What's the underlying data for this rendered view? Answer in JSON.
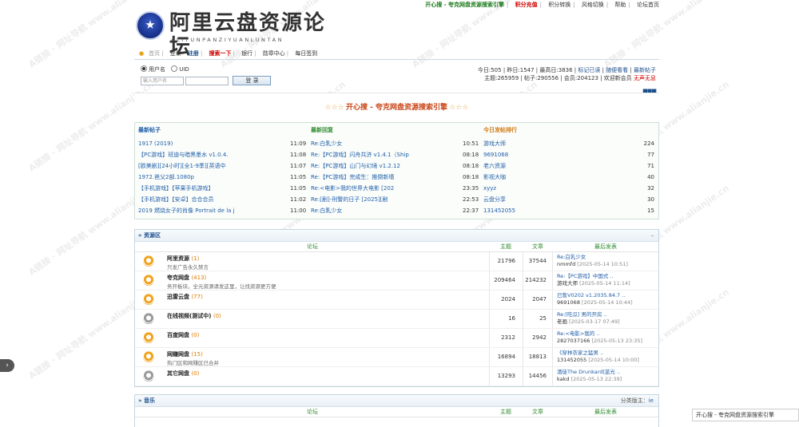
{
  "topbar": {
    "items": [
      "开心搜 - 夸克网盘资源搜索引擎",
      "积分充值",
      "积分转换",
      "风格切换",
      "帮助",
      "论坛首页"
    ],
    "separators": [
      "|",
      "|",
      "|",
      "|",
      "|"
    ]
  },
  "logo": {
    "title": "阿里云盘资源论坛",
    "subtitle": "ALIYUNPANZIYUANLUNTAN"
  },
  "nav": {
    "home": "首页",
    "items": [
      "登录",
      "注册",
      "搜索一下",
      "银行",
      "勋章中心",
      "每日签到"
    ],
    "separators": [
      "|",
      "|",
      "|",
      "|",
      "|"
    ]
  },
  "login": {
    "radio_username": "用户名",
    "radio_uid": "UID",
    "input_placeholder": "输入用户名",
    "submit": "登 录"
  },
  "stats": {
    "line1_prefix": "今日:505 | 昨日:1547 | 最高日:3836 | ",
    "line1_link1": "标记已读",
    "line1_mid": " | ",
    "line1_link2": "随便看看",
    "line1_sep2": " | ",
    "line1_link3": "最新帖子",
    "line2_prefix": "主题:265959 | 帖子:290556 | 会员:204123 | 欢迎新会员 ",
    "line2_user": "无声无息"
  },
  "dots": "■■■",
  "banner": {
    "stars_left": "☆☆☆",
    "text": "开心搜 - 夸克网盘资源搜索引擎",
    "stars_right": "☆☆☆"
  },
  "latest": {
    "new_posts_title": "最新帖子",
    "new_replies_title": "最新回复",
    "ranking_title": "今日发帖排行",
    "new_posts": [
      {
        "title": "1917 (2019)",
        "time": "11:09"
      },
      {
        "title": "【PC游戏】班迪与暗黑墨水 v1.0.4.",
        "time": "11:08"
      },
      {
        "title": "[欧美剧][24小时][全1-9季][英语中",
        "time": "11:07"
      },
      {
        "title": "1972.爸父2部.1080p",
        "time": "11:05"
      },
      {
        "title": "【手机游戏】【苹果手机游戏】",
        "time": "11:05"
      },
      {
        "title": "【手机游戏】【安卓】合合合员",
        "time": "11:02"
      },
      {
        "title": "2019 燃烧女子的肖像 Portrait de la j",
        "time": "11:00"
      }
    ],
    "new_replies": [
      {
        "title": "Re:白乳少女",
        "time": "10:51"
      },
      {
        "title": "Re:【PC游戏】闪舟共济 v1.4.1（Ship",
        "time": "08:18"
      },
      {
        "title": "Re:【PC游戏】山门与幻境 v1.2.12",
        "time": "08:18"
      },
      {
        "title": "Re:【PC游戏】完成生：推倒新墙",
        "time": "08:18"
      },
      {
        "title": "Re:<电影>我的世界大电影 [202",
        "time": "23:35"
      },
      {
        "title": "Re:[剧]-刑警的日子 [2025][剧",
        "time": "22:53"
      },
      {
        "title": "Re:白乳少女",
        "time": "22:37"
      }
    ],
    "ranking": [
      {
        "user": "游戏大师",
        "count": "224"
      },
      {
        "user": "9691068",
        "count": "77"
      },
      {
        "user": "老六资源",
        "count": "71"
      },
      {
        "user": "影视大咖",
        "count": "40"
      },
      {
        "user": "xyyz",
        "count": "32"
      },
      {
        "user": "云盘分享",
        "count": "30"
      },
      {
        "user": "131452055",
        "count": "15"
      }
    ]
  },
  "resource_section": {
    "title": "» 资源区",
    "collapse": "–",
    "col_forum": "论坛",
    "col_topics": "主题",
    "col_posts": "文章",
    "col_last": "最后发表",
    "forums": [
      {
        "name": "阿里资源",
        "count": "(1)",
        "desc": "只发广告永久禁言",
        "topics": "21796",
        "posts": "37544",
        "last_title": "Re:白乳少女",
        "last_user": "nmmfd",
        "last_date": "[2025-05-14 10:51]",
        "icon": "active"
      },
      {
        "name": "夸克网盘",
        "count": "(413)",
        "desc": "务开板块，全元资源请发这里，让找资源更方便",
        "topics": "209464",
        "posts": "214232",
        "last_title": "Re:【PC游戏】中国式 ..",
        "last_user": "游戏大师",
        "last_date": "[2025-05-14 11:14]",
        "icon": "active"
      },
      {
        "name": "迅雷云盘",
        "count": "(77)",
        "desc": "",
        "topics": "2024",
        "posts": "2047",
        "last_title": "已售V0202 v1.2035.84.7 ..",
        "last_user": "9691068",
        "last_date": "[2025-05-14 10:44]",
        "icon": "active"
      },
      {
        "name": "在线视频(测试中)",
        "count": "(0)",
        "desc": "",
        "topics": "16",
        "posts": "25",
        "last_title": "Re:[吃瓜] 男的开房 ..",
        "last_user": "老画",
        "last_date": "[2025-03-17 07:49]",
        "icon": "idle"
      },
      {
        "name": "百度网盘",
        "count": "(0)",
        "desc": "",
        "topics": "2312",
        "posts": "2942",
        "last_title": "Re:<电影>我的 ..",
        "last_user": "2827037166",
        "last_date": "[2025-05-13 23:35]",
        "icon": "active"
      },
      {
        "name": "网赚网盘",
        "count": "(15)",
        "desc": "热门区和网赚区已合并",
        "topics": "16894",
        "posts": "18813",
        "last_title": "《穿林衣家之猛男 ..",
        "last_user": "131452055",
        "last_date": "[2025-05-14 10:00]",
        "icon": "active"
      },
      {
        "name": "其它网盘",
        "count": "(0)",
        "desc": "",
        "topics": "13293",
        "posts": "14456",
        "last_title": "酒徒The Drunkard[蓝光 ..",
        "last_user": "kakd",
        "last_date": "[2025-05-13 22:39]",
        "icon": "idle"
      }
    ]
  },
  "music_section": {
    "title": "» 音乐",
    "mod_label": "分类版主：",
    "mod_user": "ie",
    "col_forum": "论坛",
    "col_topics": "主题",
    "col_posts": "文章",
    "col_last": "最后发表"
  },
  "side": {
    "left_tab": "›",
    "right_tab": "开心搜 - 夸克网盘资源搜索引擎"
  },
  "watermark": "A链接 · 网址导航 www.alianjie.cn"
}
